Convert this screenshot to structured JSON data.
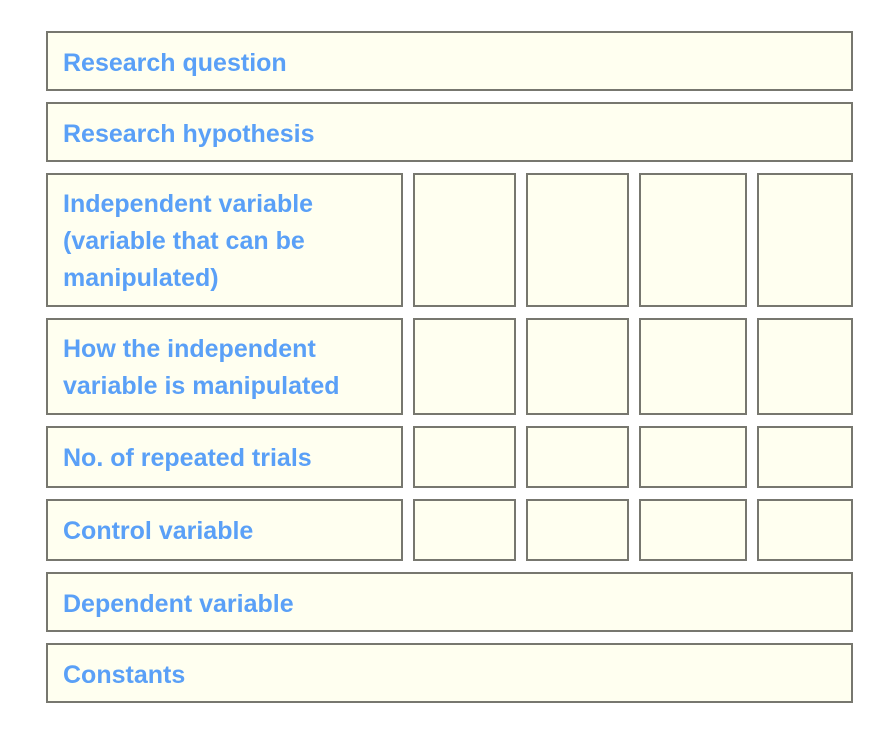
{
  "worksheet": {
    "rows": [
      {
        "label": "Research question",
        "cells": 0
      },
      {
        "label": "Research hypothesis",
        "cells": 0
      },
      {
        "label": "Independent variable (variable that can be manipulated)",
        "cells": 4
      },
      {
        "label": "How the independent variable is manipulated",
        "cells": 4
      },
      {
        "label": "No. of repeated trials",
        "cells": 4
      },
      {
        "label": "Control variable",
        "cells": 4
      },
      {
        "label": "Dependent variable",
        "cells": 0
      },
      {
        "label": "Constants",
        "cells": 0
      }
    ],
    "colors": {
      "label_text": "#5aa0f7",
      "box_fill": "#fffff0",
      "box_border": "#77776f"
    }
  }
}
